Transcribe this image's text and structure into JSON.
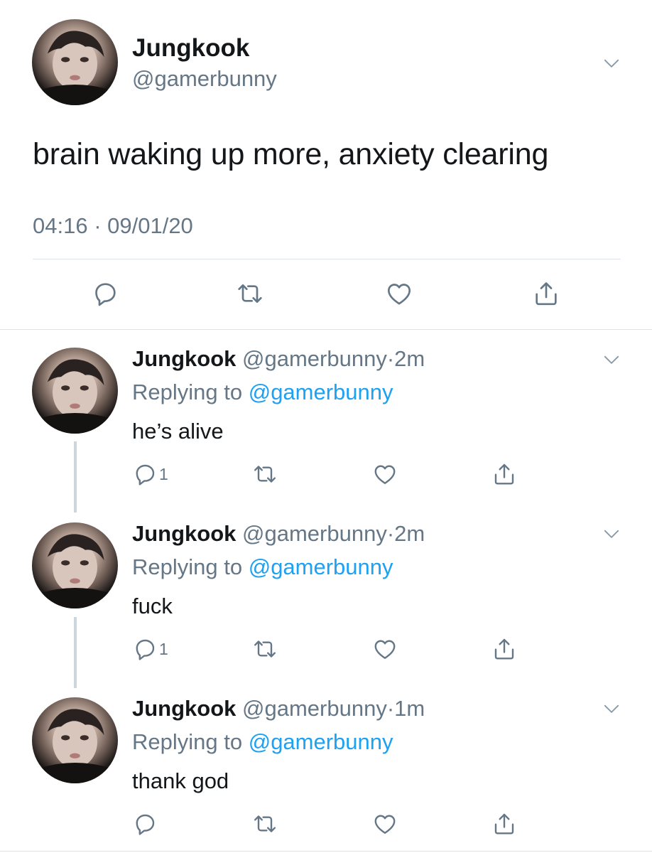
{
  "main_tweet": {
    "name": "Jungkook",
    "handle": "@gamerbunny",
    "text": "brain waking up more, anxiety clearing",
    "timestamp": "04:16 · 09/01/20",
    "icons": [
      "reply-icon",
      "retweet-icon",
      "like-icon",
      "share-icon",
      "chevron-down-icon"
    ]
  },
  "replies": [
    {
      "name": "Jungkook",
      "handle": "@gamerbunny",
      "sep": "·",
      "time": "2m",
      "replying_prefix": "Replying to ",
      "replying_to": "@gamerbunny",
      "text": "he’s alive",
      "reply_count": "1"
    },
    {
      "name": "Jungkook",
      "handle": "@gamerbunny",
      "sep": "·",
      "time": "2m",
      "replying_prefix": "Replying to ",
      "replying_to": "@gamerbunny",
      "text": "fuck",
      "reply_count": "1"
    },
    {
      "name": "Jungkook",
      "handle": "@gamerbunny",
      "sep": "·",
      "time": "1m",
      "replying_prefix": "Replying to ",
      "replying_to": "@gamerbunny",
      "text": "thank god",
      "reply_count": ""
    }
  ],
  "colors": {
    "text": "#14171a",
    "secondary": "#657786",
    "link": "#1da1f2",
    "divider": "#dde3e8",
    "thread_line": "#ccd6dd"
  }
}
